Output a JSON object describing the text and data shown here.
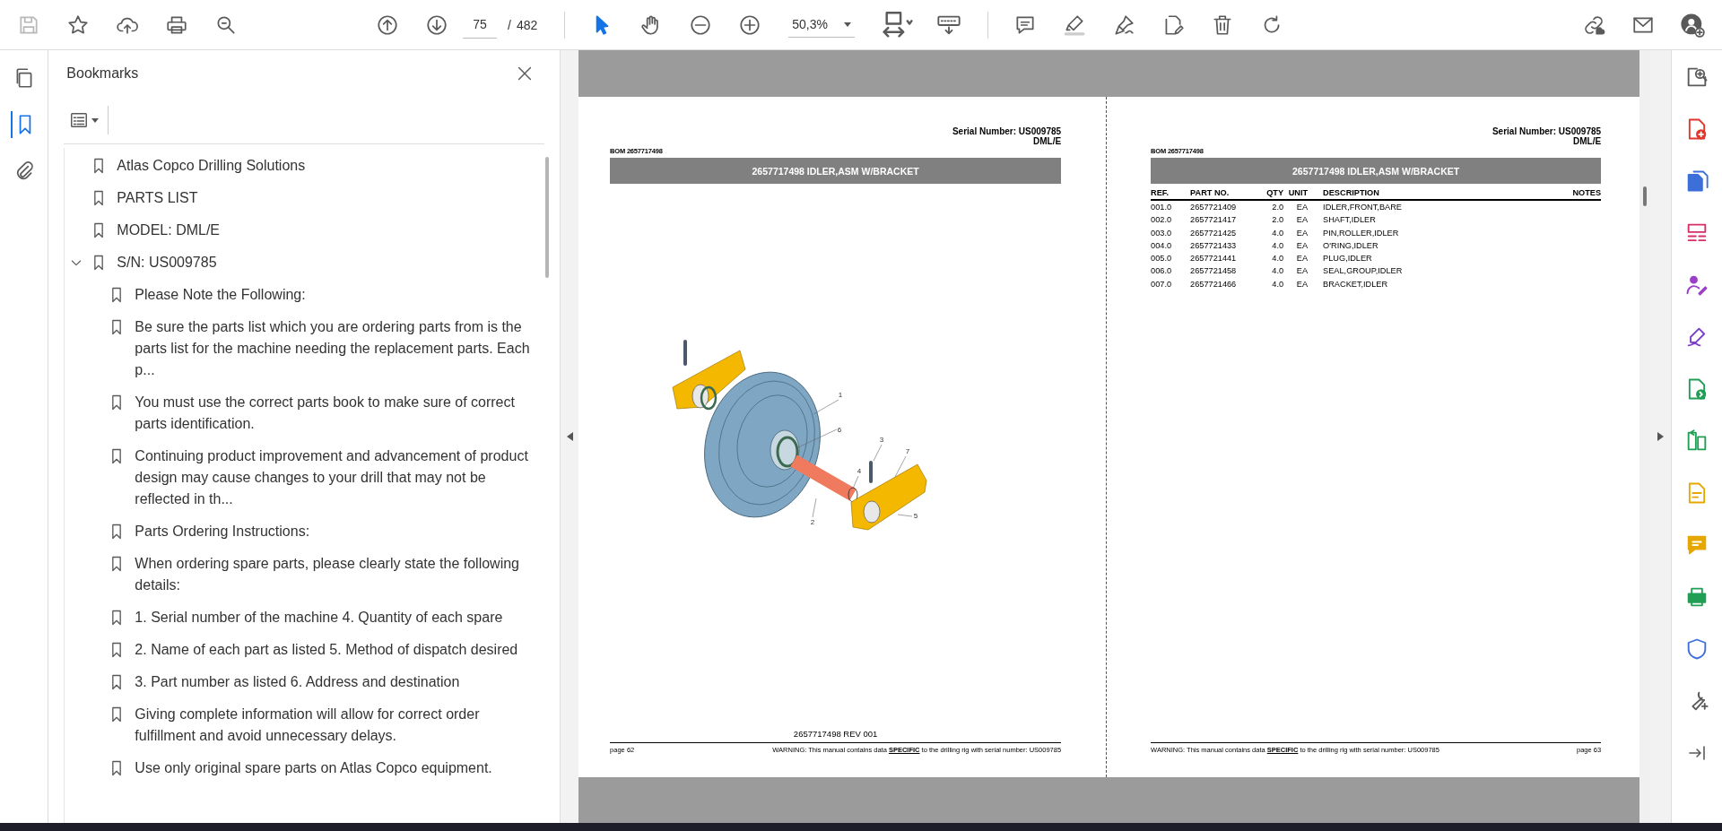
{
  "toolbar": {
    "save": {
      "disabled": true
    },
    "page_number": "75",
    "page_separator": "/",
    "page_total": "482",
    "zoom": "50,3%",
    "tools": [
      {
        "kind": "select",
        "selected": true
      },
      {
        "kind": "hand",
        "selected": false
      }
    ]
  },
  "nav_rail": [
    {
      "kind": "pages",
      "selected": false
    },
    {
      "kind": "bookmarks",
      "selected": true
    },
    {
      "kind": "attachments",
      "selected": false
    }
  ],
  "bookmarks_panel": {
    "title": "Bookmarks",
    "items": [
      {
        "title": "Atlas Copco Drilling Solutions"
      },
      {
        "title": "PARTS LIST"
      },
      {
        "title": "MODEL: DML/E"
      },
      {
        "title": "S/N: US009785",
        "expanded": true,
        "children": [
          {
            "title": "Please Note the Following:"
          },
          {
            "title": "Be sure the parts list which you are ordering parts from is the parts list for the machine needing the replacement parts. Each p..."
          },
          {
            "title": "You must use the correct parts book to make sure of correct parts identification."
          },
          {
            "title": "Continuing product improvement and advancement of product design may cause changes to your drill that may not be reflected in th..."
          },
          {
            "title": "Parts Ordering Instructions:"
          },
          {
            "title": "When ordering spare parts, please clearly state the following details:"
          },
          {
            "title": "1. Serial number of the machine 4. Quantity of each spare"
          },
          {
            "title": "2. Name of each part as listed 5. Method of dispatch desired"
          },
          {
            "title": "3. Part number as listed 6. Address and destination"
          },
          {
            "title": "Giving complete information will allow for correct order fulfillment and avoid unnecessary delays."
          },
          {
            "title": "Use only original spare parts on Atlas Copco equipment."
          }
        ]
      }
    ]
  },
  "document": {
    "pages": [
      {
        "kind": "figure",
        "serial": "Serial Number: US009785",
        "model": "DML/E",
        "bom": "BOM 2657717498",
        "title": "2657717498 IDLER,ASM W/BRACKET",
        "callouts": [
          "1",
          "6",
          "3",
          "7",
          "4",
          "2",
          "5"
        ],
        "footer_code": "2657717498 REV 001",
        "page_label": "page 62",
        "warning": "WARNING:  This manual contains data **SPECIFIC** to the drilling rig with serial number: US009785"
      },
      {
        "kind": "table",
        "serial": "Serial Number: US009785",
        "model": "DML/E",
        "bom": "BOM 2657717498",
        "title": "2657717498 IDLER,ASM W/BRACKET",
        "table": {
          "columns": [
            "REF.",
            "PART NO.",
            "QTY",
            "UNIT",
            "DESCRIPTION",
            "NOTES"
          ],
          "rows": [
            [
              "001.0",
              "2657721409",
              "2.0",
              "EA",
              "IDLER,FRONT,BARE"
            ],
            [
              "002.0",
              "2657721417",
              "2.0",
              "EA",
              "SHAFT,IDLER"
            ],
            [
              "003.0",
              "2657721425",
              "4.0",
              "EA",
              "PIN,ROLLER,IDLER"
            ],
            [
              "004.0",
              "2657721433",
              "4.0",
              "EA",
              "O'RING,IDLER"
            ],
            [
              "005.0",
              "2657721441",
              "4.0",
              "EA",
              "PLUG,IDLER"
            ],
            [
              "006.0",
              "2657721458",
              "4.0",
              "EA",
              "SEAL,GROUP,IDLER"
            ],
            [
              "007.0",
              "2657721466",
              "4.0",
              "EA",
              "BRACKET,IDLER"
            ]
          ]
        },
        "page_label": "page 63",
        "warning": "WARNING:  This manual contains data **SPECIFIC** to the drilling rig with serial number: US009785"
      }
    ]
  }
}
